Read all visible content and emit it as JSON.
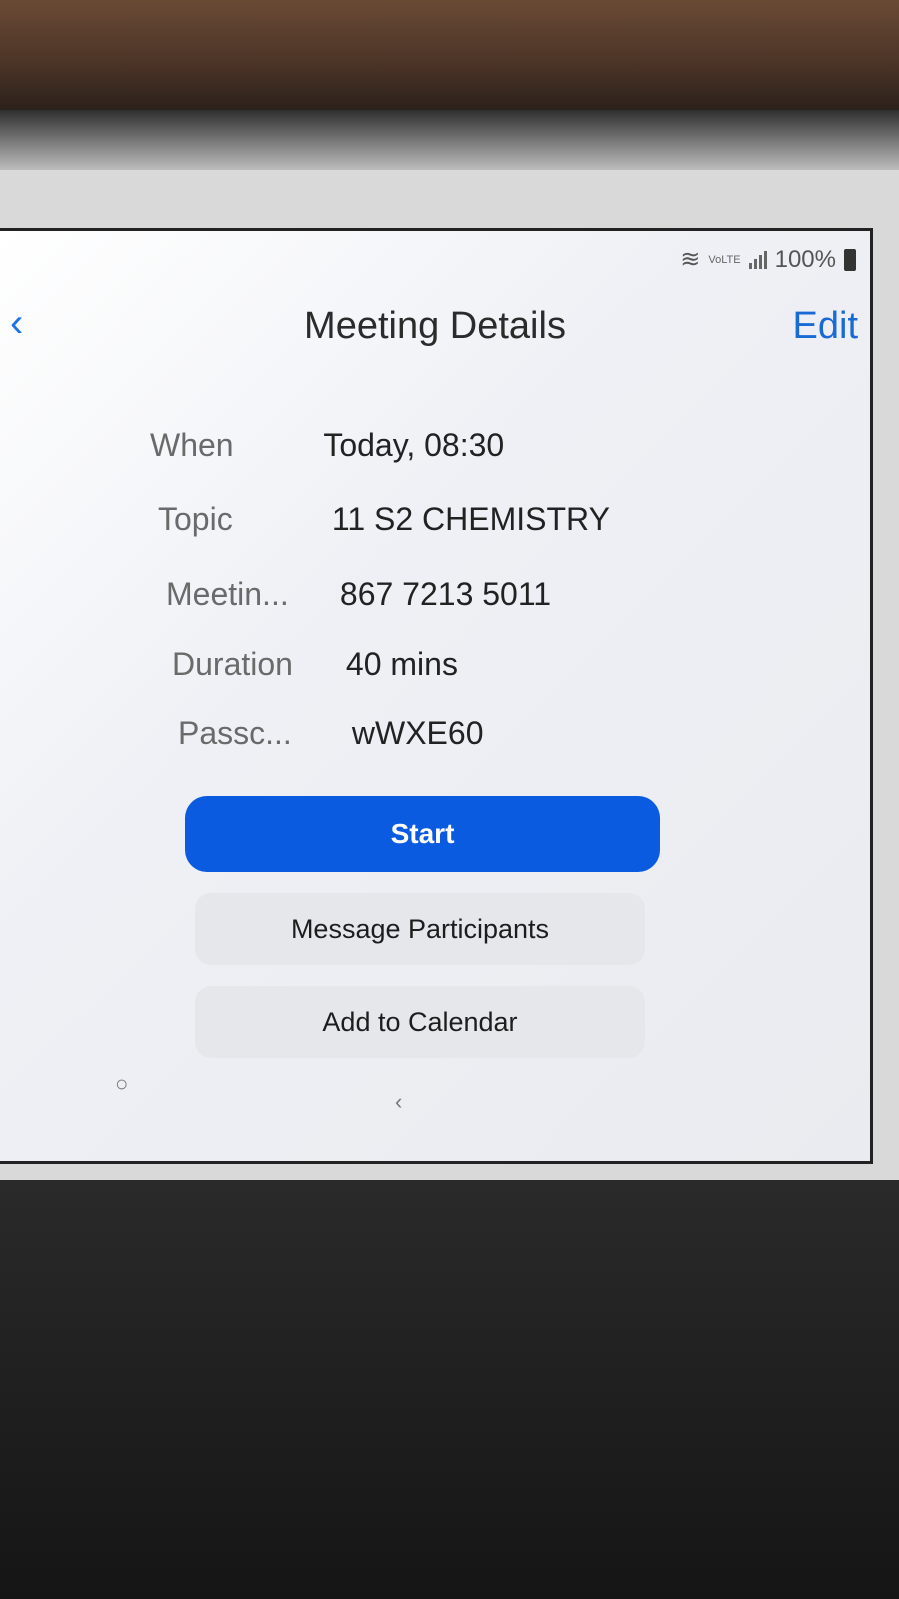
{
  "status_bar": {
    "network": "VoLTE",
    "battery": "100%"
  },
  "header": {
    "back_icon": "chevron-left-icon",
    "title": "Meeting Details",
    "edit_label": "Edit"
  },
  "details": [
    {
      "label": "When",
      "value": "Today, 08:30"
    },
    {
      "label": "Topic",
      "value": "11 S2 CHEMISTRY"
    },
    {
      "label": "Meetin...",
      "value": "867 7213 5011"
    },
    {
      "label": "Duration",
      "value": "40 mins"
    },
    {
      "label": "Passc...",
      "value": "wWXE60"
    }
  ],
  "actions": {
    "start": "Start",
    "message": "Message Participants",
    "calendar": "Add to Calendar"
  },
  "colors": {
    "accent": "#0b5be0",
    "link": "#1a6ad6"
  }
}
